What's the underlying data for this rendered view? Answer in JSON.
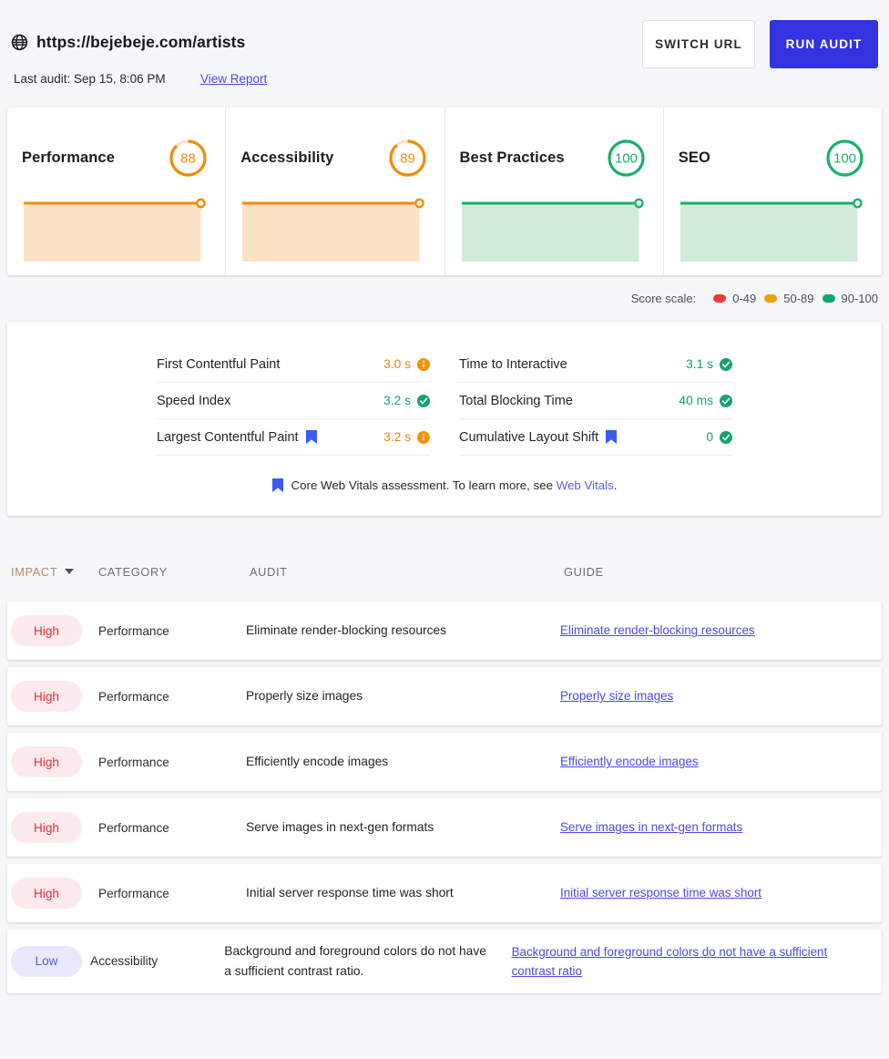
{
  "header": {
    "globe_icon": "globe-icon",
    "url": "https://bejebeje.com/artists",
    "last_audit": "Last audit: Sep 15, 8:06 PM",
    "view_report_label": "View Report",
    "switch_url_label": "SWITCH URL",
    "run_audit_label": "RUN AUDIT"
  },
  "scores": {
    "cards": [
      {
        "title": "Performance",
        "value": 88,
        "color": "#f28b0c",
        "track": "#fde3c6",
        "fill": "#fce3c6",
        "band": "50-89"
      },
      {
        "title": "Accessibility",
        "value": 89,
        "color": "#f28b0c",
        "track": "#fde3c6",
        "fill": "#fce3c6",
        "band": "50-89"
      },
      {
        "title": "Best Practices",
        "value": 100,
        "color": "#17b267",
        "track": "#cfecd9",
        "fill": "#d2ecdc",
        "band": "90-100"
      },
      {
        "title": "SEO",
        "value": 100,
        "color": "#17b267",
        "track": "#cfecd9",
        "fill": "#d2ecdc",
        "band": "90-100"
      }
    ],
    "scale_label": "Score scale:",
    "scale": [
      {
        "label": "0-49",
        "color": "#eb3b3b"
      },
      {
        "label": "50-89",
        "color": "#f59e0b"
      },
      {
        "label": "90-100",
        "color": "#13a368"
      }
    ]
  },
  "metrics": {
    "left": [
      {
        "name": "First Contentful Paint",
        "value": "3.0 s",
        "status": "warn",
        "tone": "v-orange",
        "vital": false
      },
      {
        "name": "Speed Index",
        "value": "3.2 s",
        "status": "pass",
        "tone": "v-green",
        "vital": false
      },
      {
        "name": "Largest Contentful Paint",
        "value": "3.2 s",
        "status": "warn",
        "tone": "v-orange",
        "vital": true
      }
    ],
    "right": [
      {
        "name": "Time to Interactive",
        "value": "3.1 s",
        "status": "pass",
        "tone": "v-green",
        "vital": false
      },
      {
        "name": "Total Blocking Time",
        "value": "40 ms",
        "status": "pass",
        "tone": "v-green",
        "vital": false
      },
      {
        "name": "Cumulative Layout Shift",
        "value": "0",
        "status": "pass",
        "tone": "v-green",
        "vital": true
      }
    ],
    "note_prefix": "Core Web Vitals assessment. To learn more, see ",
    "note_link": "Web Vitals",
    "note_suffix": "."
  },
  "table": {
    "columns": {
      "impact": "IMPACT",
      "category": "CATEGORY",
      "audit": "AUDIT",
      "guide": "GUIDE"
    },
    "sorted_by": "impact",
    "rows": [
      {
        "impact": "High",
        "impact_class": "badge-high",
        "category": "Performance",
        "audit": "Eliminate render-blocking resources",
        "guide": "Eliminate render-blocking resources"
      },
      {
        "impact": "High",
        "impact_class": "badge-high",
        "category": "Performance",
        "audit": "Properly size images",
        "guide": "Properly size images"
      },
      {
        "impact": "High",
        "impact_class": "badge-high",
        "category": "Performance",
        "audit": "Efficiently encode images",
        "guide": "Efficiently encode images"
      },
      {
        "impact": "High",
        "impact_class": "badge-high",
        "category": "Performance",
        "audit": "Serve images in next-gen formats",
        "guide": "Serve images in next-gen formats"
      },
      {
        "impact": "High",
        "impact_class": "badge-high",
        "category": "Performance",
        "audit": "Initial server response time was short",
        "guide": "Initial server response time was short"
      },
      {
        "impact": "Low",
        "impact_class": "badge-low",
        "category": "Accessibility",
        "audit": "Background and foreground colors do not have a sufficient contrast ratio.",
        "guide": "Background and foreground colors do not have a sufficient contrast ratio"
      }
    ]
  }
}
